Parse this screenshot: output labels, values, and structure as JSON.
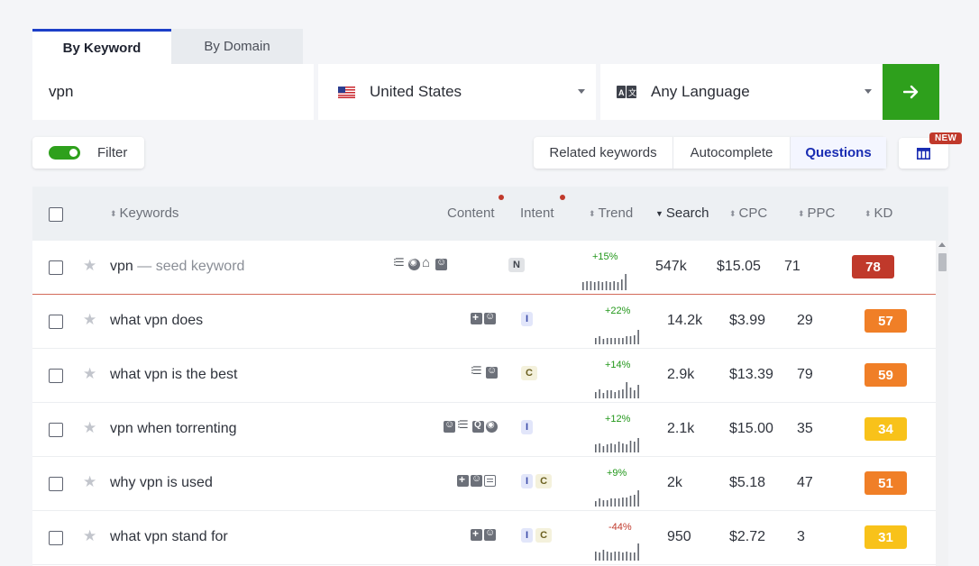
{
  "tabs": [
    {
      "label": "By Keyword",
      "active": true
    },
    {
      "label": "By Domain",
      "active": false
    }
  ],
  "search": {
    "keyword_value": "vpn",
    "country": "United States",
    "language": "Any Language",
    "go_icon": "arrow-right-icon"
  },
  "filter": {
    "label": "Filter",
    "enabled": true
  },
  "segments": [
    "Related keywords",
    "Autocomplete",
    "Questions"
  ],
  "active_segment": "Questions",
  "new_badge": "NEW",
  "columns": {
    "keywords": "Keywords",
    "content": "Content",
    "intent": "Intent",
    "trend": "Trend",
    "search": "Search",
    "cpc": "CPC",
    "ppc": "PPC",
    "kd": "KD"
  },
  "rows": [
    {
      "keyword": "vpn",
      "seed_tag": "— seed keyword",
      "content_icons": [
        "list-icon",
        "chrome-icon",
        "home-icon",
        "reddit-icon"
      ],
      "intent": [
        "N"
      ],
      "trend": "+15%",
      "trend_dir": "up",
      "search": "547k",
      "cpc": "$15.05",
      "ppc": "71",
      "kd": "78",
      "kd_color": "#c0392b",
      "spark": [
        6,
        7,
        7,
        6,
        7,
        6,
        7,
        6,
        7,
        6,
        8,
        12
      ]
    },
    {
      "keyword": "what vpn does",
      "seed_tag": "",
      "content_icons": [
        "plus-icon",
        "reddit-icon"
      ],
      "intent": [
        "I"
      ],
      "trend": "+22%",
      "trend_dir": "up",
      "search": "14.2k",
      "cpc": "$3.99",
      "ppc": "29",
      "kd": "57",
      "kd_color": "#f07f27",
      "spark": [
        5,
        6,
        4,
        5,
        5,
        5,
        5,
        5,
        6,
        6,
        7,
        11
      ]
    },
    {
      "keyword": "what vpn is the best",
      "seed_tag": "",
      "content_icons": [
        "list-icon",
        "reddit-icon"
      ],
      "intent": [
        "C"
      ],
      "trend": "+14%",
      "trend_dir": "up",
      "search": "2.9k",
      "cpc": "$13.39",
      "ppc": "79",
      "kd": "59",
      "kd_color": "#f07f27",
      "spark": [
        5,
        7,
        4,
        6,
        6,
        5,
        6,
        7,
        12,
        8,
        6,
        10
      ]
    },
    {
      "keyword": "vpn when torrenting",
      "seed_tag": "",
      "content_icons": [
        "reddit-icon",
        "list-icon",
        "quora-icon",
        "chat-icon"
      ],
      "intent": [
        "I"
      ],
      "trend": "+12%",
      "trend_dir": "up",
      "search": "2.1k",
      "cpc": "$15.00",
      "ppc": "35",
      "kd": "34",
      "kd_color": "#f8c21a",
      "spark": [
        6,
        7,
        5,
        6,
        7,
        6,
        8,
        7,
        6,
        9,
        8,
        11
      ]
    },
    {
      "keyword": "why vpn is used",
      "seed_tag": "",
      "content_icons": [
        "plus-icon",
        "reddit-icon",
        "news-icon"
      ],
      "intent": [
        "I",
        "C"
      ],
      "trend": "+9%",
      "trend_dir": "up",
      "search": "2k",
      "cpc": "$5.18",
      "ppc": "47",
      "kd": "51",
      "kd_color": "#f07f27",
      "spark": [
        4,
        6,
        5,
        5,
        6,
        6,
        6,
        7,
        7,
        8,
        9,
        12
      ]
    },
    {
      "keyword": "what vpn stand for",
      "seed_tag": "",
      "content_icons": [
        "plus-icon",
        "reddit-icon"
      ],
      "intent": [
        "I",
        "C"
      ],
      "trend": "-44%",
      "trend_dir": "down",
      "search": "950",
      "cpc": "$2.72",
      "ppc": "3",
      "kd": "31",
      "kd_color": "#f8c21a",
      "spark": [
        7,
        6,
        8,
        7,
        6,
        7,
        7,
        6,
        7,
        6,
        6,
        13
      ]
    }
  ]
}
